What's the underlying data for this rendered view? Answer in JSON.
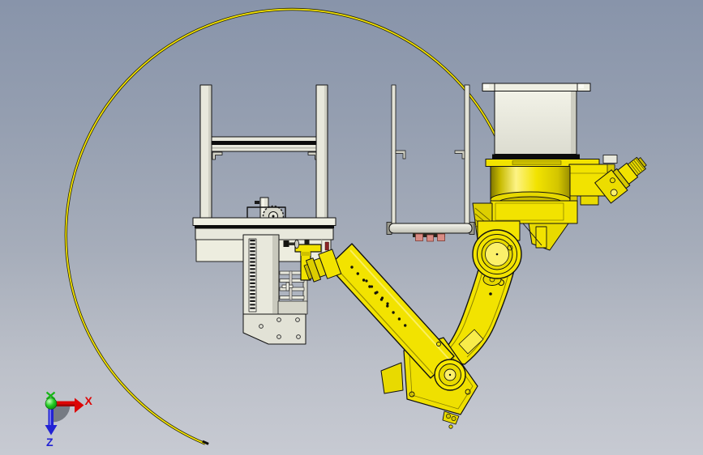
{
  "scene": {
    "type": "cad-viewport",
    "description": "3D CAD side view of an inverted industrial robot arm hanging from a pedestal, reaching to a gantry slide fixture, with a circular motion-path arc and origin axis triad",
    "axis_triad": {
      "x_label": "X",
      "z_label": "Z"
    },
    "parts": [
      "motion-path-arc",
      "gantry-frame",
      "slide-carriage-assembly",
      "part-stand-frame",
      "robot-pedestal",
      "robot-base",
      "robot-shoulder-joint",
      "robot-upper-arm",
      "robot-elbow-joint",
      "robot-forearm",
      "robot-wrist",
      "mount-bracket",
      "axis-triad"
    ],
    "colors": {
      "background_top": "#8894aa",
      "background_bottom": "#c7cad2",
      "robot_yellow": "#f2e300",
      "robot_yellow_bright": "#fbf06a",
      "robot_yellow_dark": "#b8ab00",
      "structure_light": "#e8e8dc",
      "structure_shade": "#c8c8be",
      "outline": "#111111",
      "path_arc": "#f2e100",
      "red_mark": "#8b2525",
      "gripper_pad_pink": "#d98c84",
      "axis_x_red": "#dd0505",
      "axis_z_blue": "#2222d4",
      "axis_origin_green": "#18c818"
    }
  }
}
